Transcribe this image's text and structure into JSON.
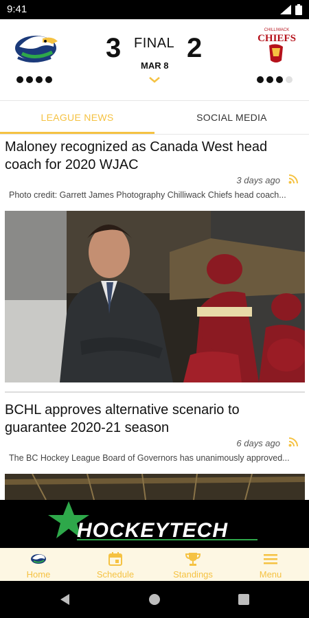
{
  "status_bar": {
    "time": "9:41"
  },
  "scoreboard": {
    "home_team": {
      "logo": "eagle-logo",
      "score": "3",
      "shots_dots_filled": 4,
      "shots_dots_total": 4
    },
    "away_team": {
      "logo": "chiefs-logo",
      "logo_text": "CHIEFS",
      "logo_subtext": "CHILLIWACK",
      "score": "2",
      "shots_dots_filled": 3,
      "shots_dots_total": 4
    },
    "status": "FINAL",
    "date": "MAR 8"
  },
  "tabs": [
    {
      "label": "LEAGUE NEWS",
      "active": true
    },
    {
      "label": "SOCIAL MEDIA",
      "active": false
    }
  ],
  "articles": [
    {
      "title": "Maloney recognized as Canada West head coach for 2020 WJAC",
      "time": "3 days ago",
      "summary": "Photo credit: Garrett James Photography Chilliwack Chiefs head coach..."
    },
    {
      "title": "BCHL approves alternative scenario to guarantee 2020-21 season",
      "time": "6 days ago",
      "summary": "The BC Hockey League Board of Governors has unanimously approved..."
    }
  ],
  "ad": {
    "brand": "HockeyTech",
    "display": "HOCKEYTECH"
  },
  "bottom_nav": [
    {
      "label": "Home",
      "icon": "team-logo-icon"
    },
    {
      "label": "Schedule",
      "icon": "calendar-icon"
    },
    {
      "label": "Standings",
      "icon": "trophy-icon"
    },
    {
      "label": "Menu",
      "icon": "hamburger-icon"
    }
  ],
  "colors": {
    "accent": "#f5c242",
    "text": "#111111",
    "chiefs_red": "#b5121b",
    "ad_green": "#2ea84a"
  }
}
